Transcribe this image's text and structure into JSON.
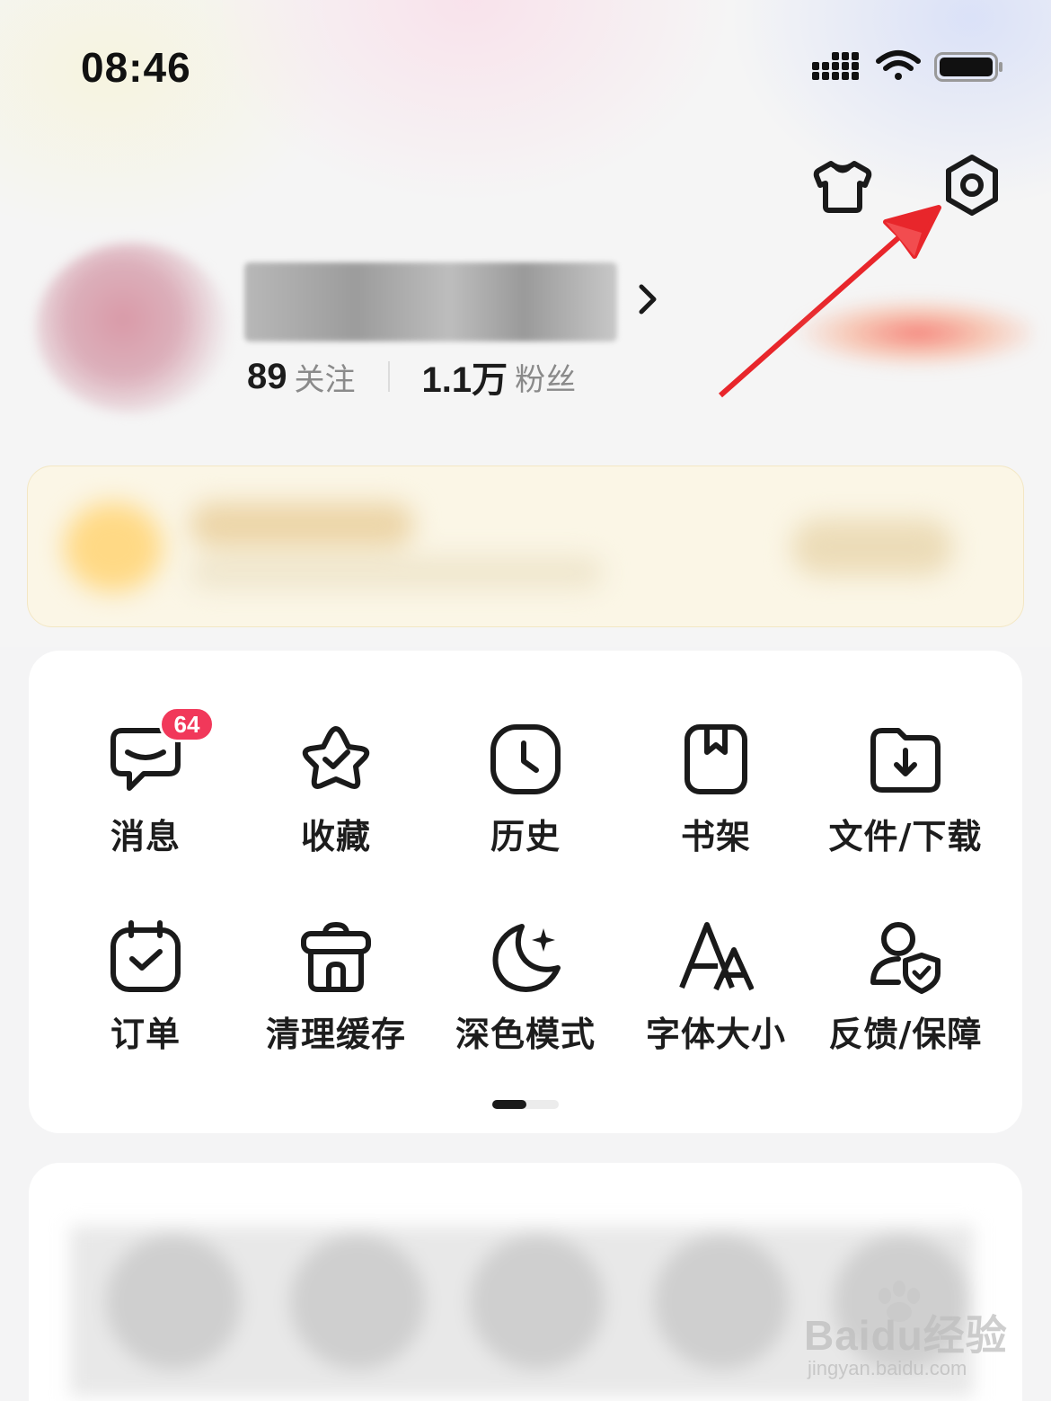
{
  "status_bar": {
    "time": "08:46"
  },
  "profile": {
    "name_redacted": "",
    "following_count": "89",
    "following_label": "关注",
    "followers_count": "1.1万",
    "followers_label": "粉丝"
  },
  "tools": [
    {
      "label": "消息",
      "icon": "message-icon",
      "badge": "64"
    },
    {
      "label": "收藏",
      "icon": "star-icon"
    },
    {
      "label": "历史",
      "icon": "clock-icon"
    },
    {
      "label": "书架",
      "icon": "bookshelf-icon"
    },
    {
      "label": "文件/下载",
      "icon": "download-folder-icon"
    },
    {
      "label": "订单",
      "icon": "calendar-check-icon"
    },
    {
      "label": "清理缓存",
      "icon": "trash-icon"
    },
    {
      "label": "深色模式",
      "icon": "moon-icon"
    },
    {
      "label": "字体大小",
      "icon": "font-size-icon"
    },
    {
      "label": "反馈/保障",
      "icon": "user-shield-icon"
    }
  ],
  "pager": {
    "pages": 2,
    "current": 1
  },
  "watermark": {
    "logo": "Baidu经验",
    "url": "jingyan.baidu.com"
  },
  "colors": {
    "badge": "#f1385a",
    "arrow": "#e8262b",
    "text": "#1d1d1d",
    "muted": "#8a8a8a"
  }
}
